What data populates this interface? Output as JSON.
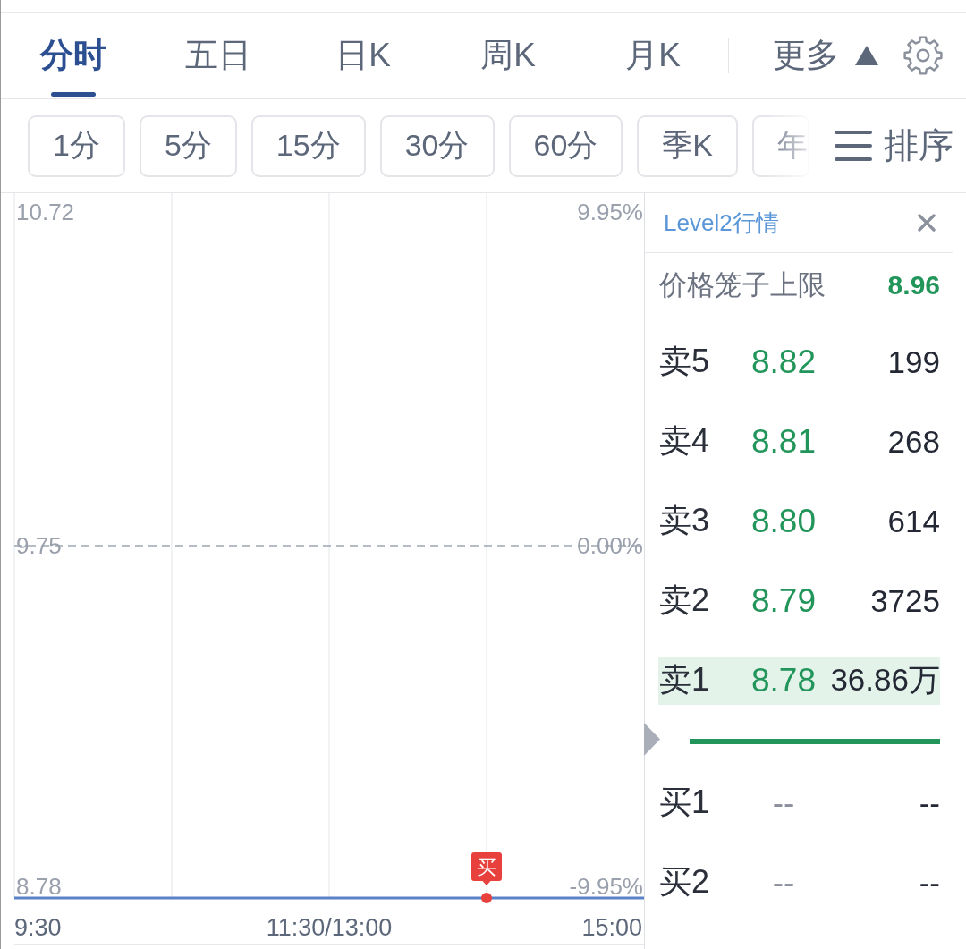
{
  "tabs": [
    {
      "label": "分时",
      "selected": true
    },
    {
      "label": "五日",
      "selected": false
    },
    {
      "label": "日K",
      "selected": false
    },
    {
      "label": "周K",
      "selected": false
    },
    {
      "label": "月K",
      "selected": false
    }
  ],
  "more_menu": {
    "label": "更多",
    "expanded": true
  },
  "periods": [
    {
      "label": "1分",
      "selected": false
    },
    {
      "label": "5分",
      "selected": false
    },
    {
      "label": "15分",
      "selected": false
    },
    {
      "label": "30分",
      "selected": false
    },
    {
      "label": "60分",
      "selected": false
    },
    {
      "label": "季K",
      "selected": false
    },
    {
      "label": "年",
      "selected": false
    }
  ],
  "sort_button": {
    "label": "排序"
  },
  "chart": {
    "price_labels": [
      "10.72",
      "9.75",
      "8.78"
    ],
    "percent_labels": [
      "9.95%",
      "0.00%",
      "-9.95%"
    ],
    "time_labels": [
      "9:30",
      "11:30/13:00",
      "15:00"
    ],
    "trade_marker": {
      "label": "买"
    }
  },
  "level2_panel": {
    "title": "Level2行情",
    "price_cage": {
      "label": "价格笼子上限",
      "value": "8.96"
    },
    "asks": [
      {
        "label": "卖5",
        "price": "8.82",
        "volume": "199",
        "color": "#21955a",
        "highlighted": false
      },
      {
        "label": "卖4",
        "price": "8.81",
        "volume": "268",
        "color": "#21955a",
        "highlighted": false
      },
      {
        "label": "卖3",
        "price": "8.80",
        "volume": "614",
        "color": "#21955a",
        "highlighted": false
      },
      {
        "label": "卖2",
        "price": "8.79",
        "volume": "3725",
        "color": "#21955a",
        "highlighted": false
      },
      {
        "label": "卖1",
        "price": "8.78",
        "volume": "36.86万",
        "color": "#21955a",
        "highlighted": true
      }
    ],
    "balance_bar": {
      "level": 1
    },
    "bids": [
      {
        "label": "买1",
        "price": "--",
        "volume": "--",
        "color": "#8a909c",
        "highlighted": false
      },
      {
        "label": "买2",
        "price": "--",
        "volume": "--",
        "color": "#8a909c",
        "highlighted": false
      }
    ]
  }
}
